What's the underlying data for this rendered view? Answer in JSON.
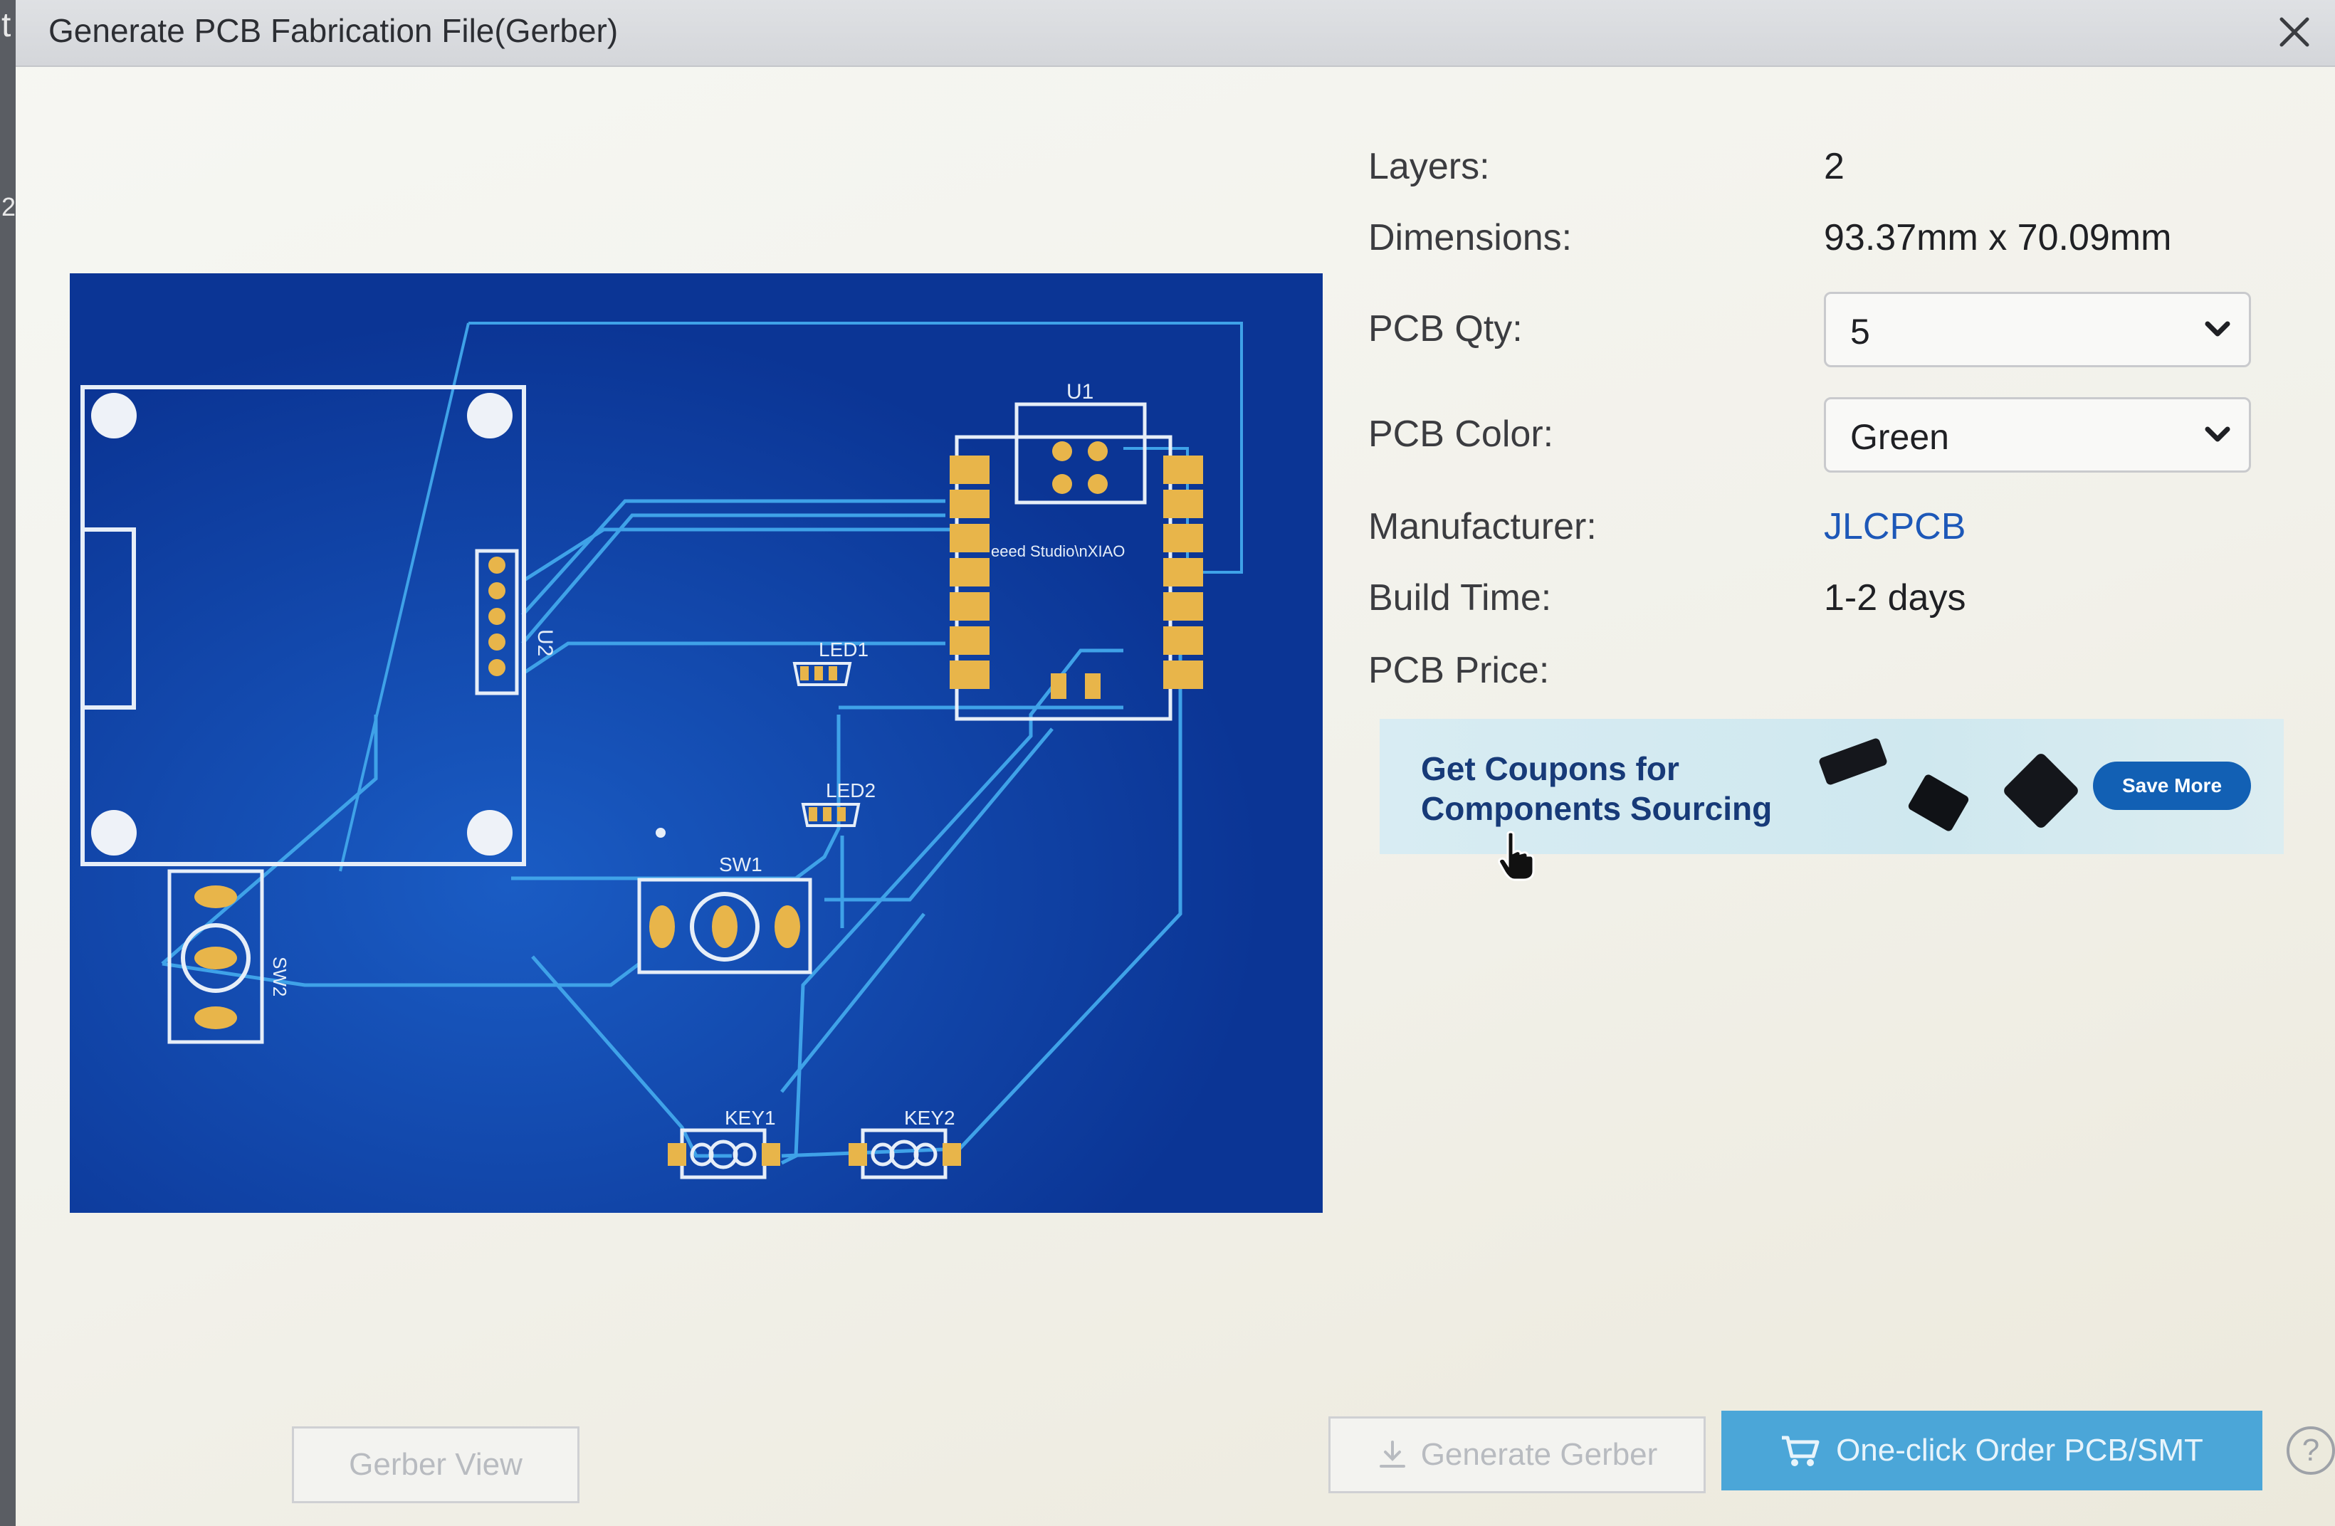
{
  "window": {
    "title": "Generate PCB Fabrication File(Gerber)",
    "left_edge_chars": [
      "t",
      "2"
    ]
  },
  "pcb_preview": {
    "labels": {
      "u1": "U1",
      "u1_text": "eeed Studio\\nXIAO",
      "u2": "U2",
      "led1": "LED1",
      "led2": "LED2",
      "sw1": "SW1",
      "sw2": "SW2",
      "key1": "KEY1",
      "key2": "KEY2"
    },
    "colors": {
      "board": "#0d3fa8",
      "trace": "#3fa2e8",
      "silkscreen": "#e6eef8",
      "pad": "#e8b54a"
    }
  },
  "info": {
    "layers_label": "Layers:",
    "layers_value": "2",
    "dimensions_label": "Dimensions:",
    "dimensions_value": "93.37mm x 70.09mm",
    "qty_label": "PCB Qty:",
    "qty_value": "5",
    "color_label": "PCB Color:",
    "color_value": "Green",
    "manufacturer_label": "Manufacturer:",
    "manufacturer_value": "JLCPCB",
    "build_time_label": "Build Time:",
    "build_time_value": "1-2 days",
    "price_label": "PCB Price:"
  },
  "banner": {
    "line1": "Get Coupons for",
    "line2": "Components Sourcing",
    "button": "Save More"
  },
  "buttons": {
    "gerber_view": "Gerber View",
    "generate_gerber": "Generate Gerber",
    "order": "One-click Order PCB/SMT",
    "help": "?"
  },
  "icons": {
    "close": "close-icon",
    "caret": "chevron-down-icon",
    "download": "download-icon",
    "cart": "cart-icon",
    "cursor": "hand-cursor-icon"
  }
}
